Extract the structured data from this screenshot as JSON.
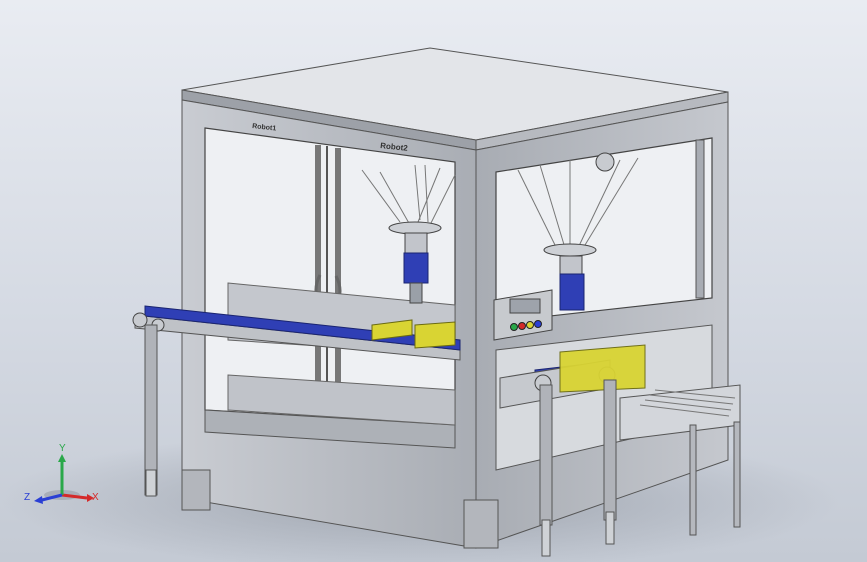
{
  "labels": {
    "robot1": "Robot1",
    "robot2": "Robot2"
  },
  "triad": {
    "x": "X",
    "y": "Y",
    "z": "Z"
  },
  "colors": {
    "frame": "#b9bcc2",
    "frame_dark": "#8d9198",
    "belt": "#2f3fb5",
    "product": "#d9d433",
    "axis_x": "#d42a2a",
    "axis_y": "#2aa84a",
    "axis_z": "#2a3fd4"
  },
  "control_panel": {
    "buttons": [
      "green",
      "red",
      "yellow",
      "blue"
    ]
  }
}
